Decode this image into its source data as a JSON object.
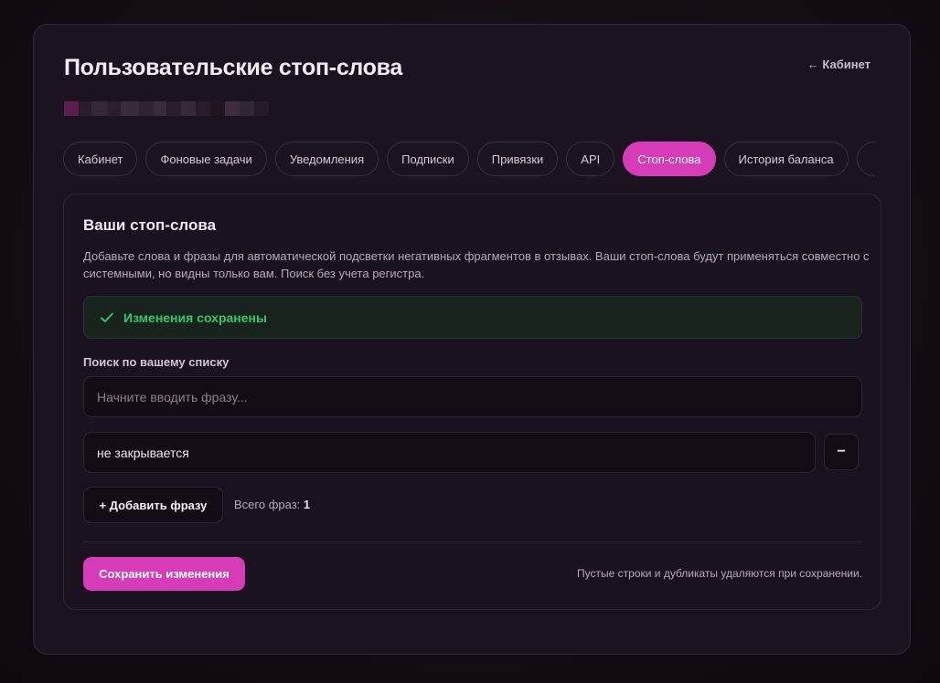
{
  "header": {
    "title": "Пользовательские стоп-слова",
    "back_link": "← Кабинет"
  },
  "tabs": [
    {
      "label": "Кабинет",
      "active": false
    },
    {
      "label": "Фоновые задачи",
      "active": false
    },
    {
      "label": "Уведомления",
      "active": false
    },
    {
      "label": "Подписки",
      "active": false
    },
    {
      "label": "Привязки",
      "active": false
    },
    {
      "label": "API",
      "active": false
    },
    {
      "label": "Стоп-слова",
      "active": true
    },
    {
      "label": "История баланса",
      "active": false
    },
    {
      "label": "",
      "active": false
    }
  ],
  "panel": {
    "title": "Ваши стоп-слова",
    "description": "Добавьте слова и фразы для автоматической подсветки негативных фрагментов в отзывах. Ваши стоп-слова будут применяться совместно с системными, но видны только вам. Поиск без учета регистра.",
    "alert": "Изменения сохранены",
    "search_label": "Поиск по вашему списку",
    "search_placeholder": "Начните вводить фразу...",
    "search_value": "",
    "phrases": [
      "не закрывается"
    ],
    "remove_label": "−",
    "add_label": "+ Добавить фразу",
    "total_label": "Всего фраз:",
    "total_count": "1",
    "save_label": "Сохранить изменения",
    "footnote": "Пустые строки и дубликаты удаляются при сохранении."
  },
  "colors": {
    "accent": "#d63bb8",
    "success": "#39c46a",
    "background": "#1c1320"
  },
  "icons": {
    "alert": "check-icon"
  }
}
